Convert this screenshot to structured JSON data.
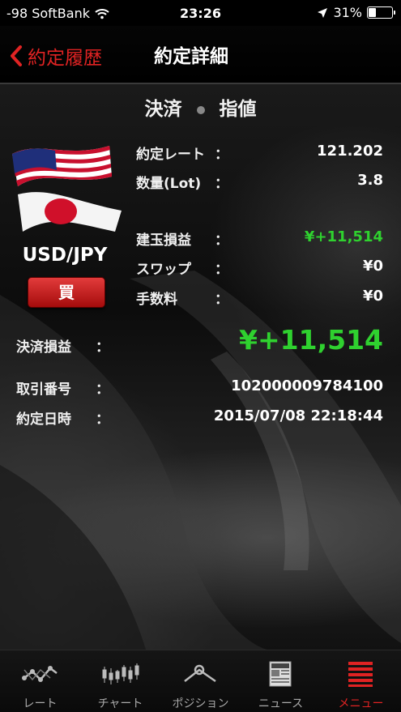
{
  "status_bar": {
    "carrier": "-98 SoftBank",
    "time": "23:26",
    "battery": "31%",
    "battery_level": 0.31
  },
  "nav": {
    "back_label": "約定履歴",
    "title": "約定詳細"
  },
  "detail": {
    "type": "決済",
    "order": "指値",
    "pair": "USD/JPY",
    "side": "買",
    "colon": "：",
    "rate_label": "約定レート",
    "rate_value": "121.202",
    "lot_label": "数量(Lot)",
    "lot_value": "3.8",
    "position_pl_label": "建玉損益",
    "position_pl_value": "¥+11,514",
    "swap_label": "スワップ",
    "swap_value": "¥0",
    "fee_label": "手数料",
    "fee_value": "¥0",
    "settle_pl_label": "決済損益",
    "settle_pl_value": "¥+11,514",
    "trade_no_label": "取引番号",
    "trade_no_value": "102000009784100",
    "date_label": "約定日時",
    "date_value": "2015/07/08 22:18:44"
  },
  "colors": {
    "accent": "#e02323",
    "profit": "#2fd12f"
  },
  "tabs": [
    {
      "label": "レート",
      "icon": "rate-chart-icon"
    },
    {
      "label": "チャート",
      "icon": "candlestick-icon"
    },
    {
      "label": "ポジション",
      "icon": "position-icon"
    },
    {
      "label": "ニュース",
      "icon": "news-icon"
    },
    {
      "label": "メニュー",
      "icon": "menu-icon",
      "active": true
    }
  ]
}
